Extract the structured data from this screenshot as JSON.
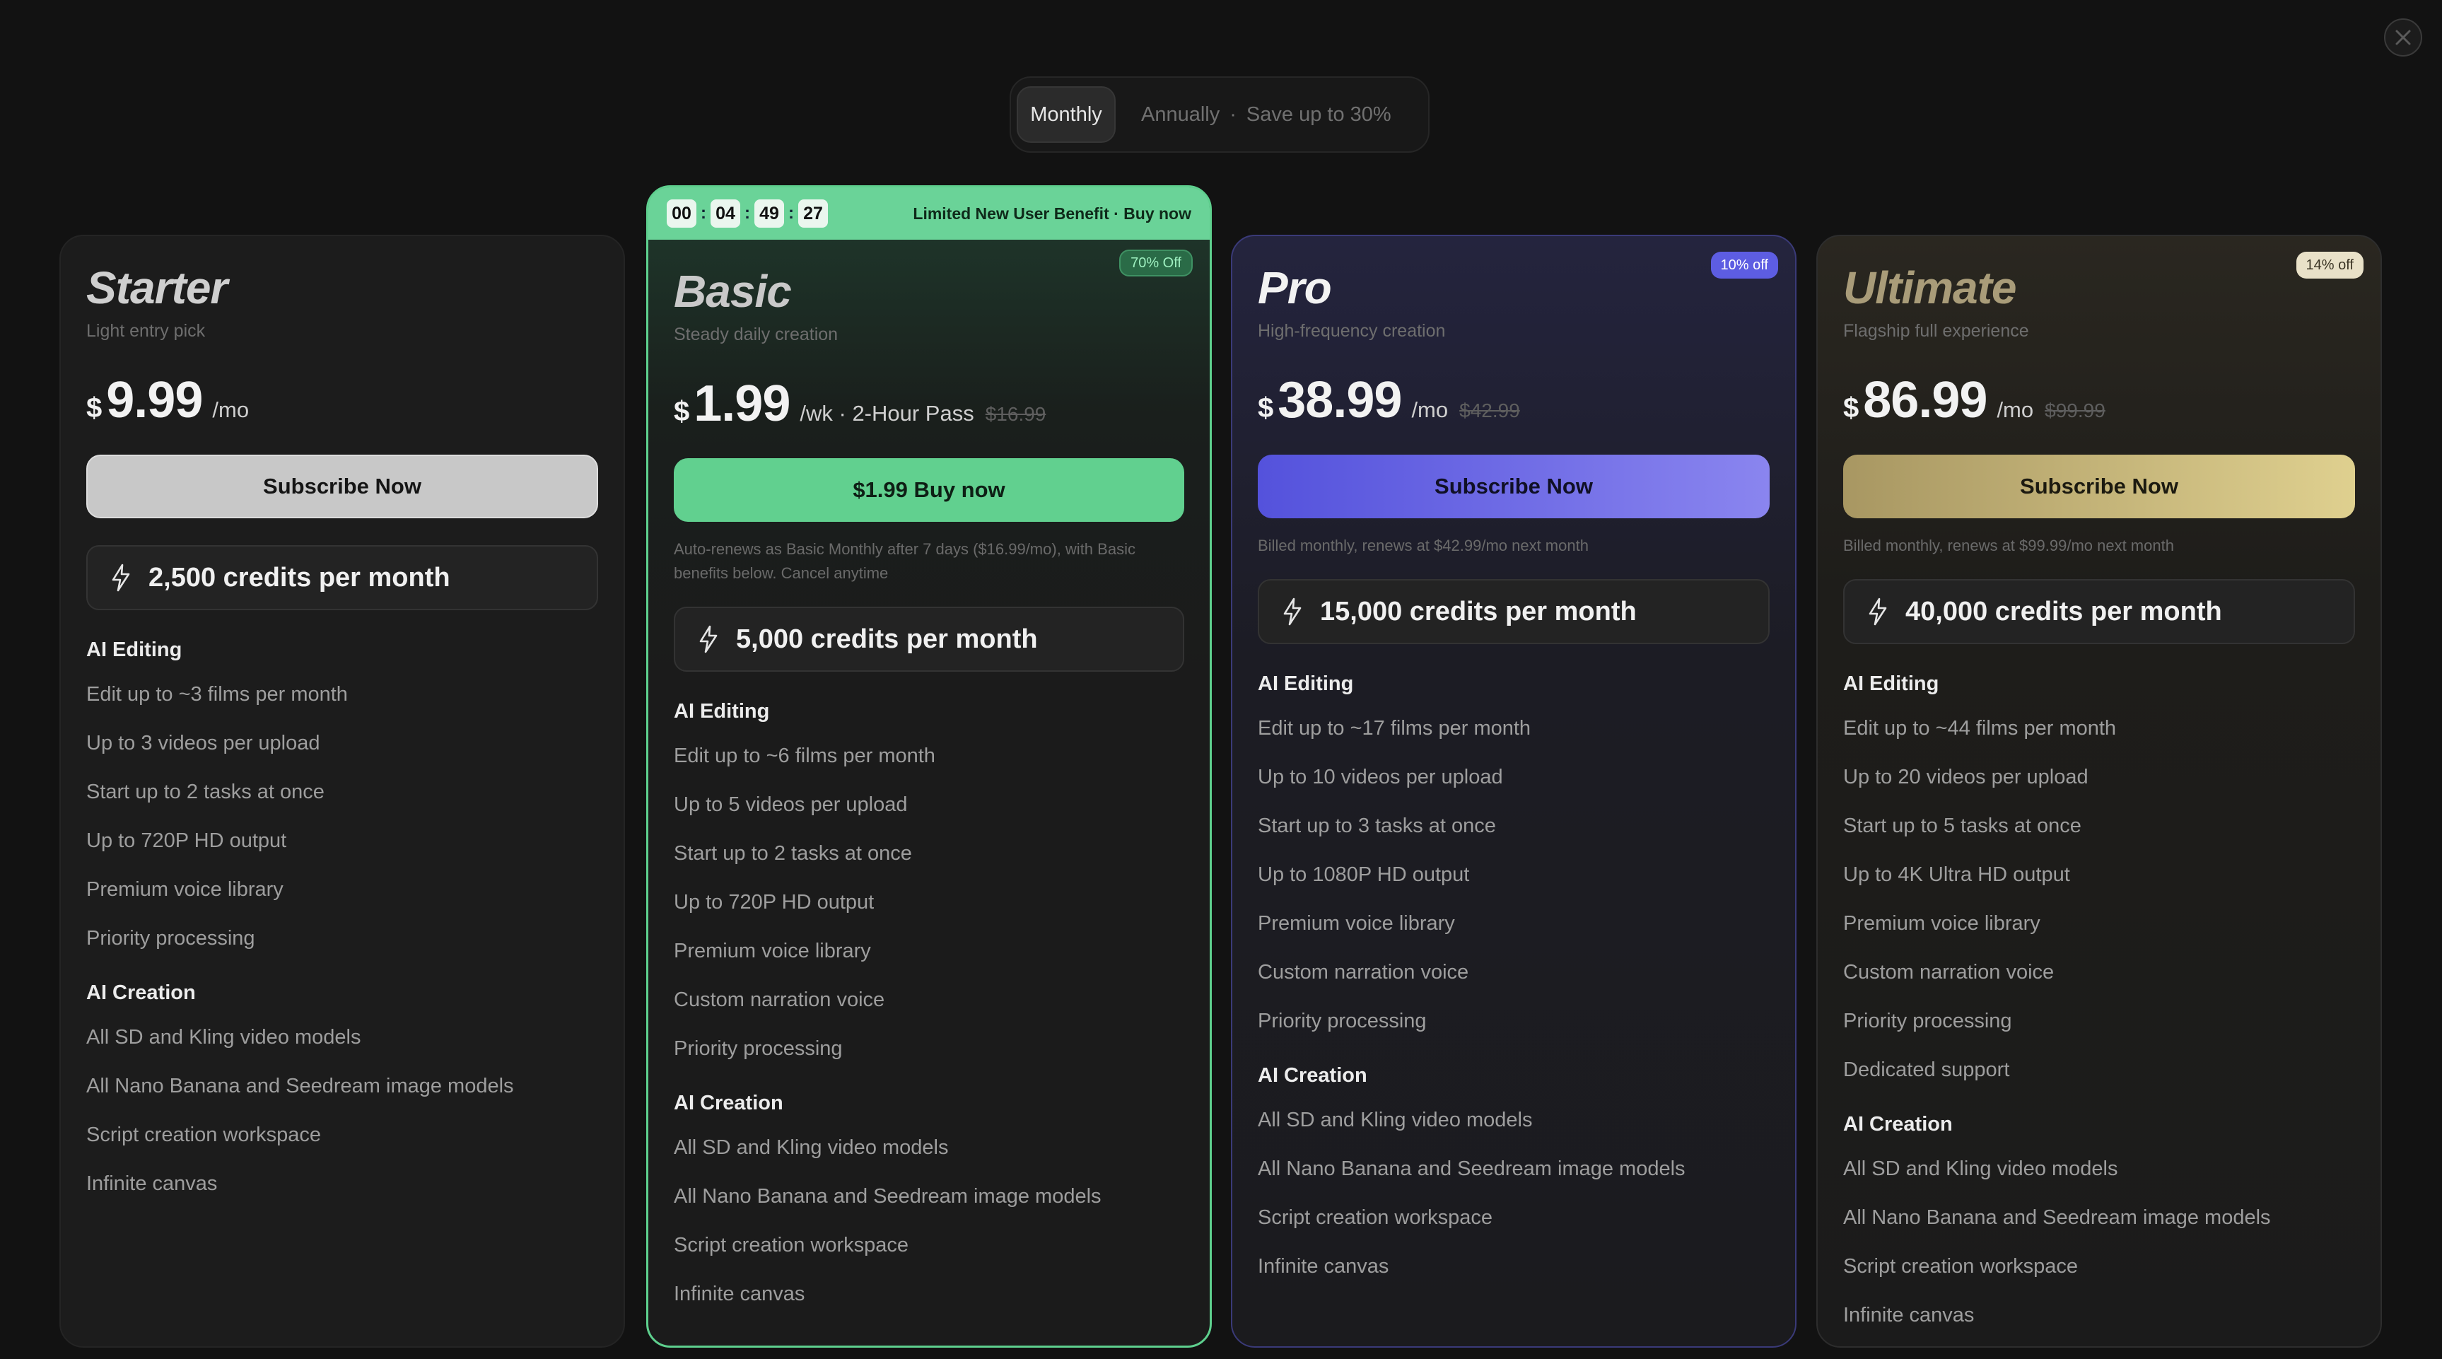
{
  "billing_toggle": {
    "monthly_label": "Monthly",
    "annually_label": "Annually",
    "separator": "·",
    "save_label": "Save up to 30%"
  },
  "close_icon": "close-icon",
  "plans": {
    "starter": {
      "name": "Starter",
      "subtitle": "Light entry pick",
      "currency": "$",
      "price": "9.99",
      "period": "/mo",
      "cta": "Subscribe Now",
      "credits": "2,500 credits per month",
      "section1": "AI Editing",
      "features1": [
        "Edit up to ~3 films per month",
        "Up to 3 videos per upload",
        "Start up to 2 tasks at once",
        "Up to 720P HD output",
        "Premium voice library",
        "Priority processing"
      ],
      "section2": "AI Creation",
      "features2": [
        "All SD and Kling video models",
        "All Nano Banana and Seedream image models",
        "Script creation workspace",
        "Infinite canvas"
      ]
    },
    "basic": {
      "timer": [
        "00",
        "04",
        "49",
        "27"
      ],
      "timer_sep": ":",
      "promo": "Limited New User Benefit · Buy now",
      "badge": "70% Off",
      "name": "Basic",
      "subtitle": "Steady daily creation",
      "currency": "$",
      "price": "1.99",
      "period": "/wk · 2-Hour Pass",
      "original_price": "$16.99",
      "cta": "$1.99 Buy now",
      "note": "Auto-renews as Basic Monthly after 7 days ($16.99/mo), with Basic benefits below. Cancel anytime",
      "credits": "5,000 credits per month",
      "section1": "AI Editing",
      "features1": [
        "Edit up to ~6 films per month",
        "Up to 5 videos per upload",
        "Start up to 2 tasks at once",
        "Up to 720P HD output",
        "Premium voice library",
        "Custom narration voice",
        "Priority processing"
      ],
      "section2": "AI Creation",
      "features2": [
        "All SD and Kling video models",
        "All Nano Banana and Seedream image models",
        "Script creation workspace",
        "Infinite canvas"
      ]
    },
    "pro": {
      "badge": "10% off",
      "name": "Pro",
      "subtitle": "High-frequency creation",
      "currency": "$",
      "price": "38.99",
      "period": "/mo",
      "original_price": "$42.99",
      "cta": "Subscribe Now",
      "note": "Billed monthly, renews at $42.99/mo next month",
      "credits": "15,000 credits per month",
      "section1": "AI Editing",
      "features1": [
        "Edit up to ~17 films per month",
        "Up to 10 videos per upload",
        "Start up to 3 tasks at once",
        "Up to 1080P HD output",
        "Premium voice library",
        "Custom narration voice",
        "Priority processing"
      ],
      "section2": "AI Creation",
      "features2": [
        "All SD and Kling video models",
        "All Nano Banana and Seedream image models",
        "Script creation workspace",
        "Infinite canvas"
      ]
    },
    "ultimate": {
      "badge": "14% off",
      "name": "Ultimate",
      "subtitle": "Flagship full experience",
      "currency": "$",
      "price": "86.99",
      "period": "/mo",
      "original_price": "$99.99",
      "cta": "Subscribe Now",
      "note": "Billed monthly, renews at $99.99/mo next month",
      "credits": "40,000 credits per month",
      "section1": "AI Editing",
      "features1": [
        "Edit up to ~44 films per month",
        "Up to 20 videos per upload",
        "Start up to 5 tasks at once",
        "Up to 4K Ultra HD output",
        "Premium voice library",
        "Custom narration voice",
        "Priority processing",
        "Dedicated support"
      ],
      "section2": "AI Creation",
      "features2": [
        "All SD and Kling video models",
        "All Nano Banana and Seedream image models",
        "Script creation workspace",
        "Infinite canvas"
      ]
    }
  },
  "colors": {
    "background": "#121212",
    "basic_accent": "#61d08f",
    "pro_accent": "#5d5de2",
    "ultimate_accent": "#dfd08f"
  }
}
